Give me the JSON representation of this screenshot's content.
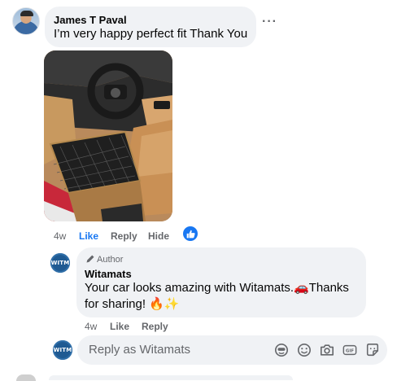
{
  "comment": {
    "author": "James T Paval",
    "text": "I’m very happy perfect fit Thank You",
    "more_label": "···",
    "actions": {
      "time": "4w",
      "like": "Like",
      "reply": "Reply",
      "hide": "Hide"
    }
  },
  "reply": {
    "author_badge": "Author",
    "author": "Witamats",
    "text_line1": "Your car looks amazing with Witamats.🚗Thanks",
    "text_line2": "for sharing! 🔥✨",
    "avatar_text": "WITM",
    "actions": {
      "time": "4w",
      "like": "Like",
      "reply": "Reply"
    }
  },
  "composer": {
    "avatar_text": "WITM",
    "placeholder": "Reply as Witamats",
    "icons": [
      "avatar-sticker-icon",
      "emoji-icon",
      "camera-icon",
      "gif-icon",
      "sticker-icon"
    ]
  },
  "colors": {
    "accent": "#1877f2",
    "bubble": "#f0f2f5",
    "muted": "#65676b",
    "brand_logo": "#1f5a92"
  }
}
